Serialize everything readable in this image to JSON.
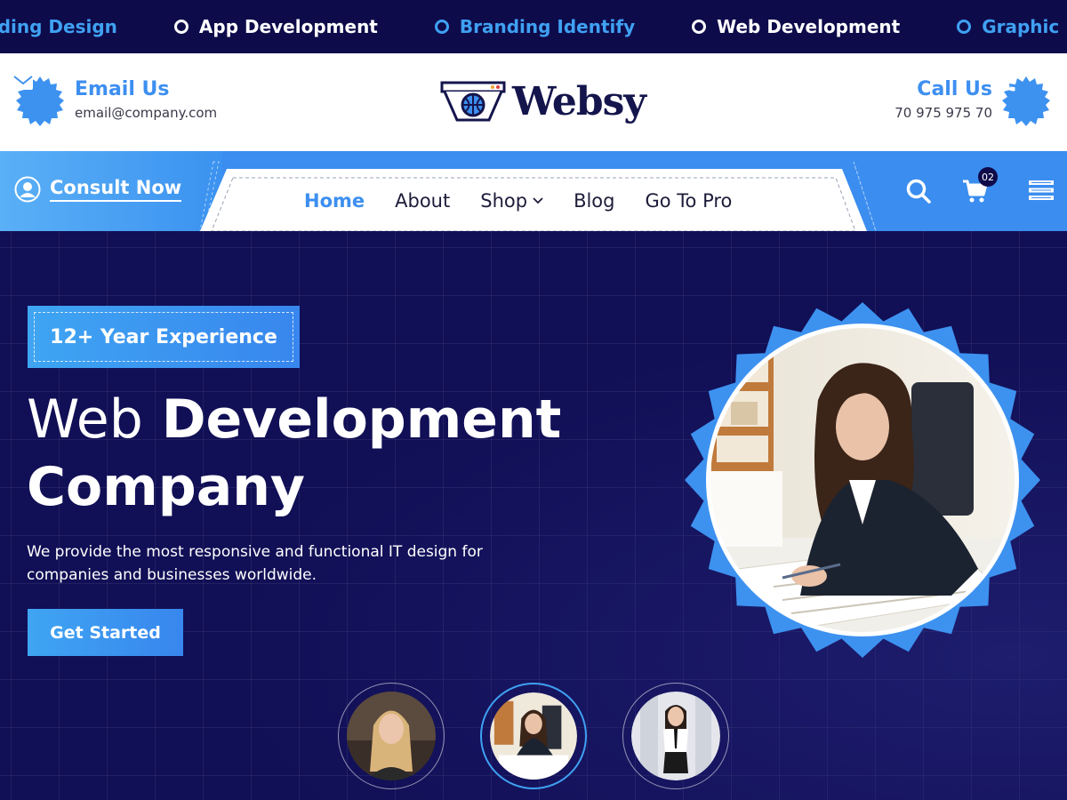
{
  "ticker": {
    "items": [
      {
        "label": "anding Design",
        "style": "alt"
      },
      {
        "label": "App Development",
        "style": "plain"
      },
      {
        "label": "Branding Identify",
        "style": "alt"
      },
      {
        "label": "Web Development",
        "style": "plain"
      },
      {
        "label": "Graphic Design",
        "style": "alt"
      }
    ]
  },
  "header": {
    "email_title": "Email Us",
    "email_address": "email@company.com",
    "logo_text": "Websy",
    "call_title": "Call Us",
    "phone_number": "70 975 975 70"
  },
  "nav": {
    "consult_label": "Consult Now",
    "items": [
      {
        "label": "Home",
        "active": true
      },
      {
        "label": "About"
      },
      {
        "label": "Shop",
        "dropdown": true
      },
      {
        "label": "Blog"
      },
      {
        "label": "Go To Pro"
      }
    ],
    "cart_count": "02"
  },
  "hero": {
    "experience_badge": "12+ Year Experience",
    "title_light": "Web",
    "title_bold": "Development",
    "title_line2": "Company",
    "description": "We provide the most responsive and functional IT design for companies and businesses worldwide.",
    "cta_label": "Get Started",
    "active_thumb": 2
  },
  "colors": {
    "navy": "#0e0b4b",
    "accent_blue": "#3d8ff0",
    "light_blue": "#3fa1f2",
    "white": "#ffffff"
  },
  "icons": [
    "email-icon",
    "phone-icon",
    "user-icon",
    "search-icon",
    "cart-icon",
    "menu-icon",
    "chevron-down-icon",
    "logo-icon"
  ]
}
